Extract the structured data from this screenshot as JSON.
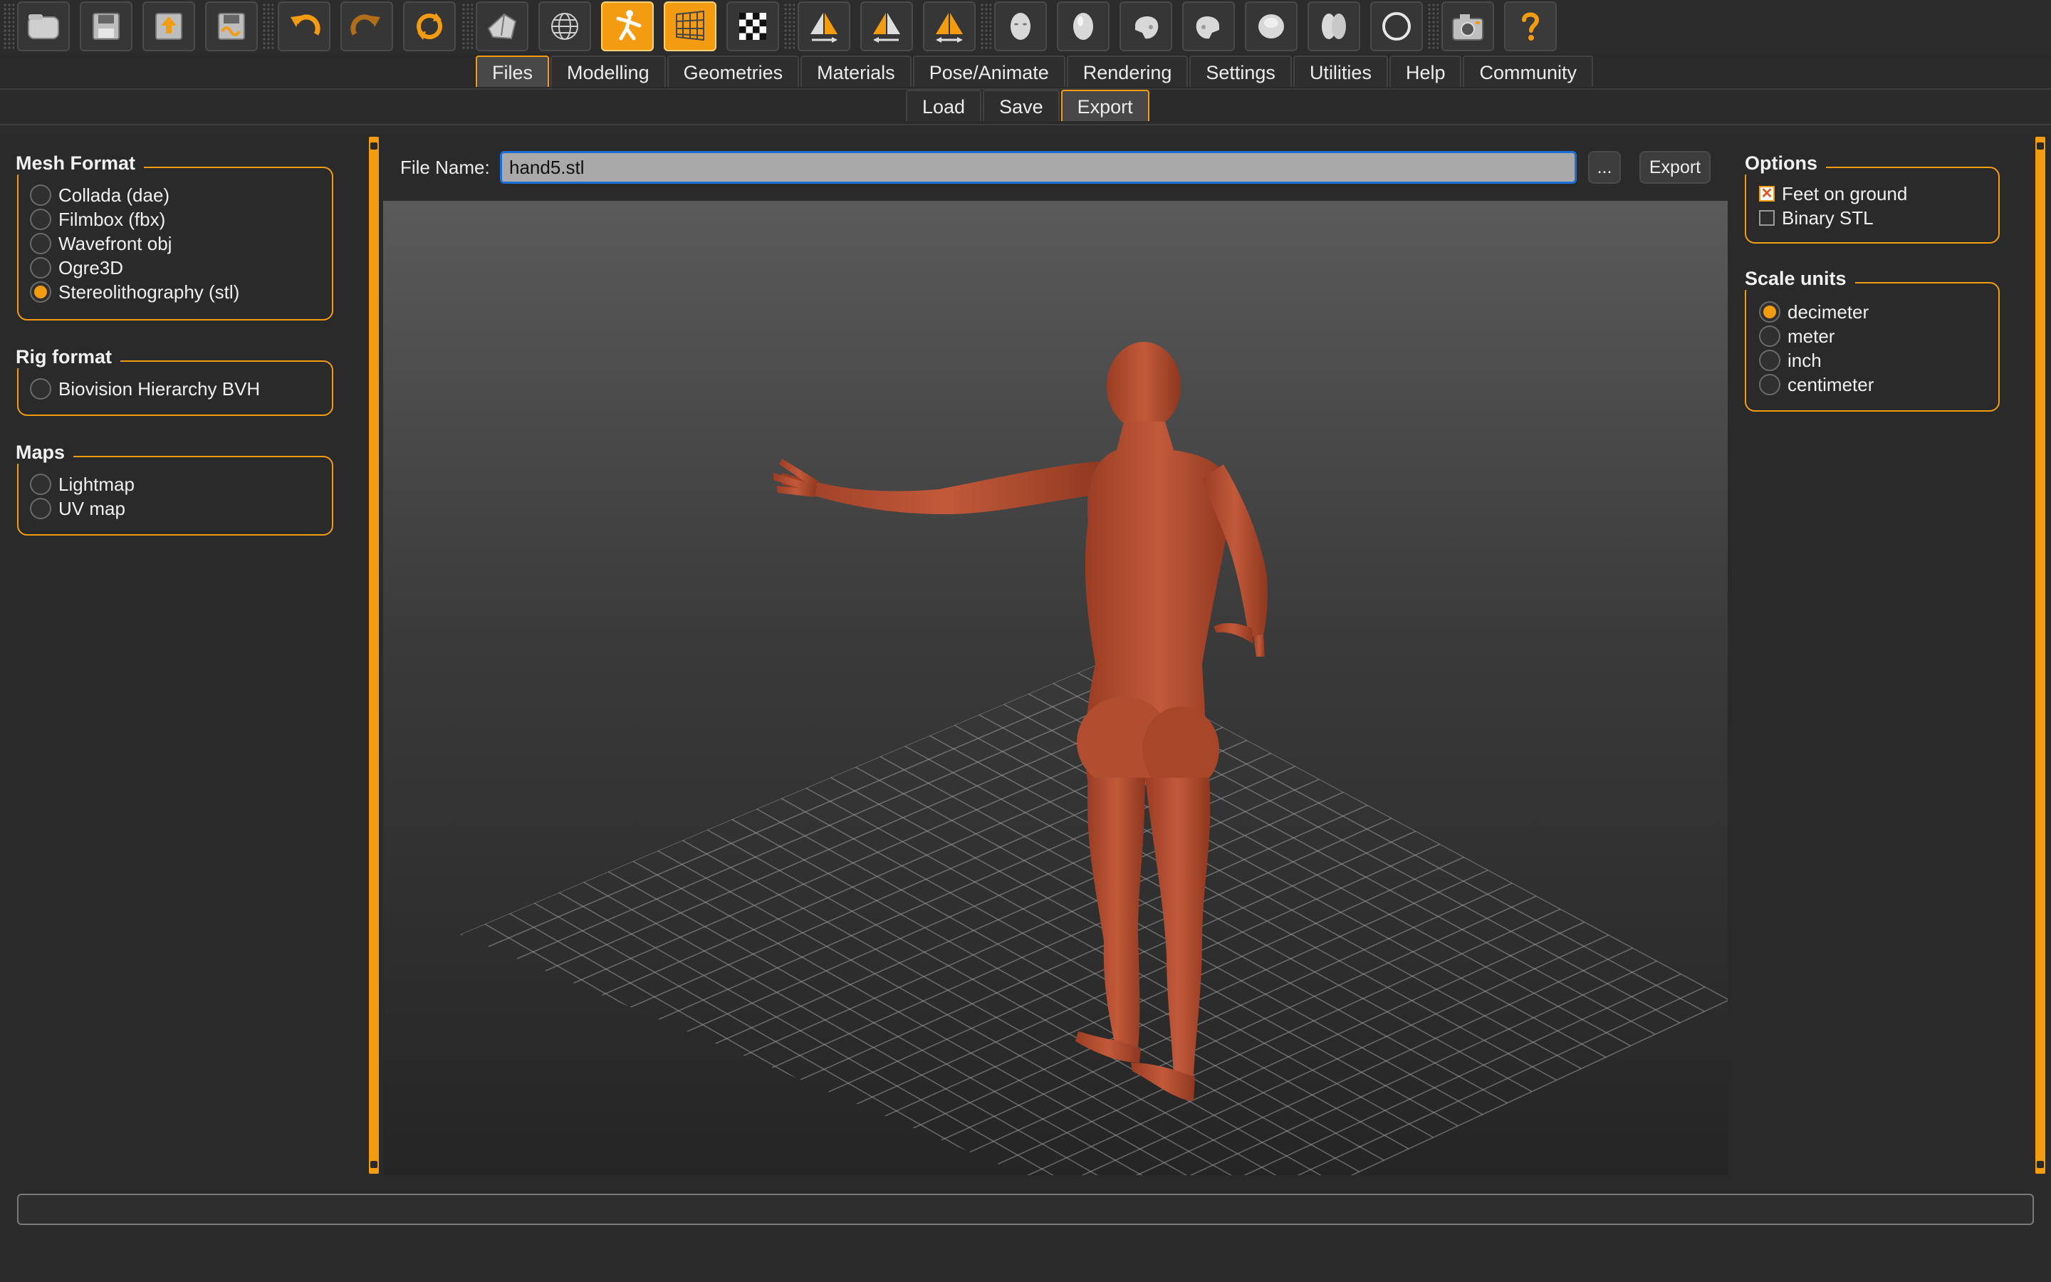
{
  "toolbar": {
    "buttons": [
      {
        "icon": "load-icon"
      },
      {
        "icon": "save-icon"
      },
      {
        "icon": "export-icon"
      },
      {
        "icon": "export-file-icon"
      },
      {
        "icon": "undo-icon"
      },
      {
        "icon": "redo-icon"
      },
      {
        "icon": "reset-icon"
      },
      {
        "icon": "smooth-icon"
      },
      {
        "icon": "wireframe-icon"
      },
      {
        "icon": "pose-icon"
      },
      {
        "icon": "background-grid-icon"
      },
      {
        "icon": "checker-icon"
      },
      {
        "icon": "symmetry-right-icon"
      },
      {
        "icon": "symmetry-left-icon"
      },
      {
        "icon": "symmetry-both-icon"
      },
      {
        "icon": "front-view-icon"
      },
      {
        "icon": "back-view-icon"
      },
      {
        "icon": "left-view-icon"
      },
      {
        "icon": "right-view-icon"
      },
      {
        "icon": "top-view-icon"
      },
      {
        "icon": "bottom-view-icon"
      },
      {
        "icon": "reset-camera-icon"
      },
      {
        "icon": "screenshot-icon"
      },
      {
        "icon": "help-icon"
      }
    ]
  },
  "tabs": [
    "Files",
    "Modelling",
    "Geometries",
    "Materials",
    "Pose/Animate",
    "Rendering",
    "Settings",
    "Utilities",
    "Help",
    "Community"
  ],
  "active_tab": "Files",
  "subtabs": [
    "Load",
    "Save",
    "Export"
  ],
  "active_subtab": "Export",
  "left": {
    "mesh_format": {
      "title": "Mesh Format",
      "options": [
        "Collada (dae)",
        "Filmbox (fbx)",
        "Wavefront obj",
        "Ogre3D",
        "Stereolithography (stl)"
      ],
      "selected": "Stereolithography (stl)"
    },
    "rig_format": {
      "title": "Rig format",
      "options": [
        "Biovision Hierarchy BVH"
      ]
    },
    "maps": {
      "title": "Maps",
      "options": [
        "Lightmap",
        "UV map"
      ]
    }
  },
  "center": {
    "file_name_label": "File Name:",
    "file_name_value": "hand5.stl",
    "browse_label": "...",
    "export_label": "Export"
  },
  "right": {
    "options": {
      "title": "Options",
      "items": [
        {
          "label": "Feet on ground",
          "checked": true
        },
        {
          "label": "Binary STL",
          "checked": false
        }
      ]
    },
    "scale_units": {
      "title": "Scale units",
      "options": [
        "decimeter",
        "meter",
        "inch",
        "centimeter"
      ],
      "selected": "decimeter"
    }
  },
  "colors": {
    "accent": "#f39c12",
    "background": "#2a2a2a",
    "model": "#b04a2c",
    "focus": "#1d6fd6"
  }
}
